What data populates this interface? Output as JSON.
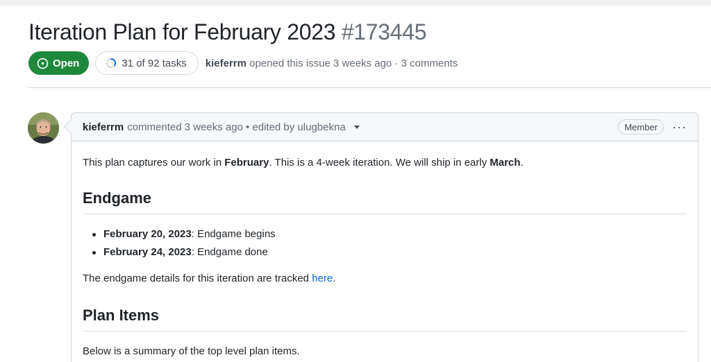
{
  "issue": {
    "title": "Iteration Plan for February 2023",
    "number": "#173445",
    "state": "Open",
    "tasks": "31 of 92 tasks",
    "tasks_progress": 0.337,
    "author": "kieferrm",
    "opened_text": "opened this issue 3 weeks ago · 3 comments"
  },
  "comment": {
    "author": "kieferrm",
    "commented": "commented 3 weeks ago",
    "edited": "• edited by ulugbekna",
    "role": "Member",
    "menu": "···",
    "intro": {
      "pre": "This plan captures our work in ",
      "b1": "February",
      "mid": ". This is a 4-week iteration. We will ship in early ",
      "b2": "March",
      "post": "."
    },
    "endgame_heading": "Endgame",
    "endgame_items": [
      {
        "date": "February 20, 2023",
        "text": ": Endgame begins"
      },
      {
        "date": "February 24, 2023",
        "text": ": Endgame done"
      }
    ],
    "tracked": {
      "pre": "The endgame details for this iteration are tracked ",
      "link": "here",
      "post": "."
    },
    "plan_heading": "Plan Items",
    "summary": "Below is a summary of the top level plan items."
  },
  "colors": {
    "open_green": "#1f883d",
    "link_blue": "#0969da",
    "border": "#d0d7de",
    "muted": "#656d76"
  }
}
